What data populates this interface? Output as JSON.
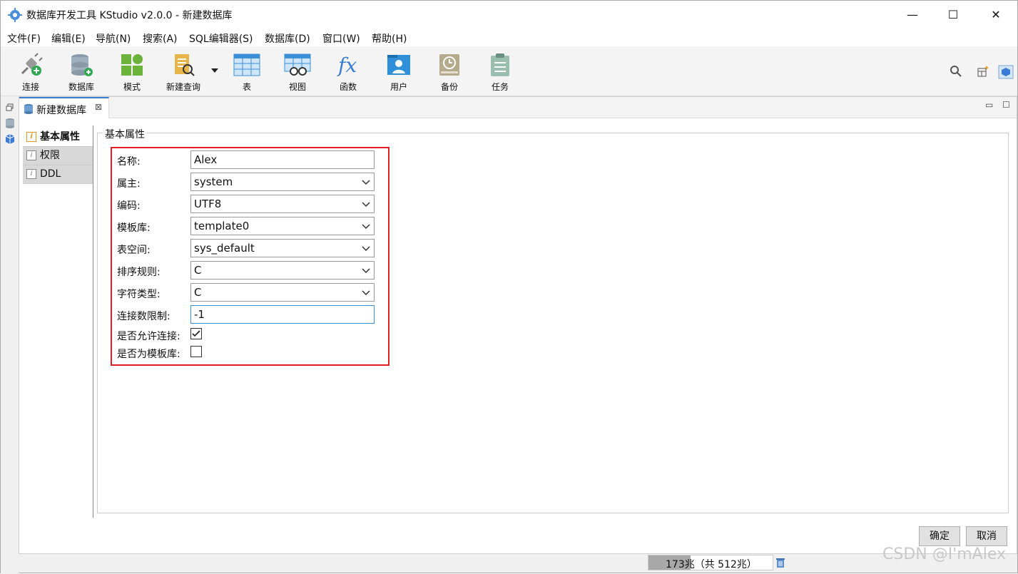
{
  "window": {
    "title": "数据库开发工具 KStudio v2.0.0 - 新建数据库",
    "minimize": "—",
    "maximize": "☐",
    "close": "✕"
  },
  "menu": [
    "文件(F)",
    "编辑(E)",
    "导航(N)",
    "搜索(A)",
    "SQL编辑器(S)",
    "数据库(D)",
    "窗口(W)",
    "帮助(H)"
  ],
  "toolbar": {
    "connect": "连接",
    "database": "数据库",
    "schema": "模式",
    "new_query": "新建查询",
    "table": "表",
    "view": "视图",
    "function": "函数",
    "user": "用户",
    "backup": "备份",
    "task": "任务"
  },
  "tab": {
    "label": "新建数据库",
    "close": "⊠"
  },
  "nav": [
    "基本属性",
    "权限",
    "DDL"
  ],
  "group_title": "基本属性",
  "form": {
    "name_label": "名称:",
    "name_value": "Alex",
    "owner_label": "属主:",
    "owner_value": "system",
    "encoding_label": "编码:",
    "encoding_value": "UTF8",
    "template_label": "模板库:",
    "template_value": "template0",
    "tablespace_label": "表空间:",
    "tablespace_value": "sys_default",
    "collation_label": "排序规则:",
    "collation_value": "C",
    "ctype_label": "字符类型:",
    "ctype_value": "C",
    "connlimit_label": "连接数限制:",
    "connlimit_value": "-1",
    "allow_conn_label": "是否允许连接:",
    "allow_conn_checked": true,
    "is_template_label": "是否为模板库:",
    "is_template_checked": false
  },
  "buttons": {
    "ok": "确定",
    "cancel": "取消"
  },
  "status": {
    "memory": "173兆（共 512兆）",
    "used_fraction": 0.338
  },
  "watermark": "CSDN @I'mAlex"
}
